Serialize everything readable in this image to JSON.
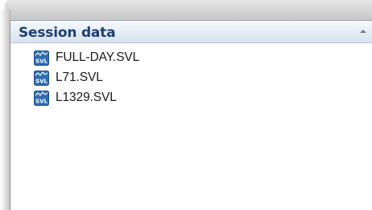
{
  "panel": {
    "title": "Session data",
    "collapse_icon": "caret-up-icon",
    "files": [
      {
        "name": "FULL-DAY.SVL",
        "icon": "svl-file-icon"
      },
      {
        "name": "L71.SVL",
        "icon": "svl-file-icon"
      },
      {
        "name": "L1329.SVL",
        "icon": "svl-file-icon"
      }
    ]
  },
  "colors": {
    "header_text": "#1e3f72",
    "icon_blue": "#2f6db3",
    "icon_label": "#ffffff"
  }
}
